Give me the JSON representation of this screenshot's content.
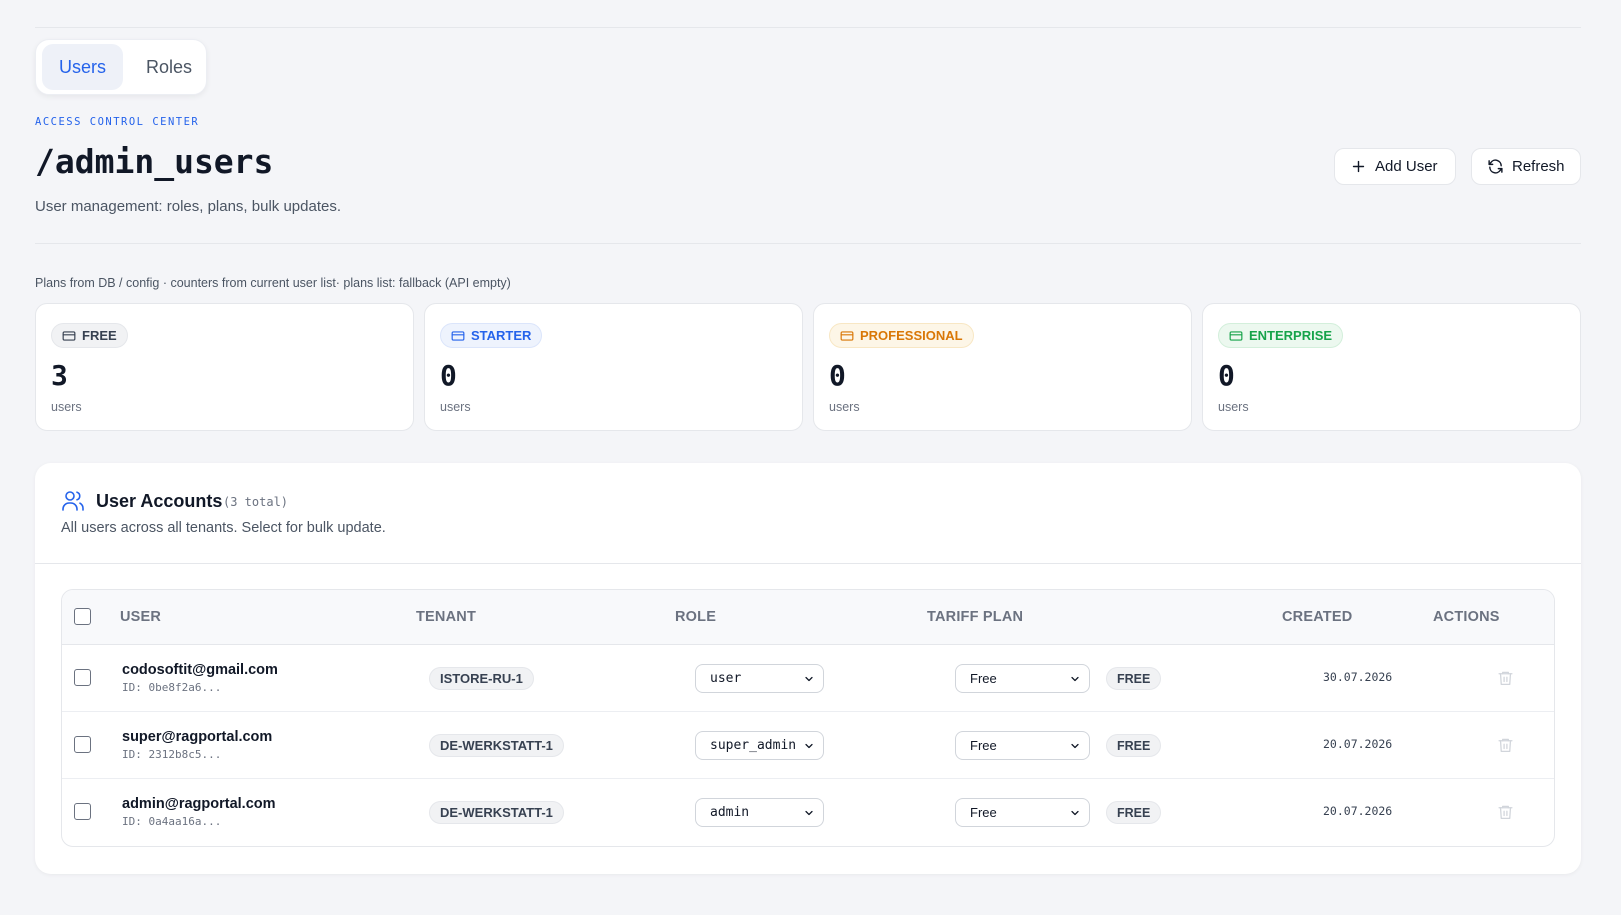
{
  "tabs": [
    {
      "label": "Users",
      "active": true
    },
    {
      "label": "Roles",
      "active": false
    }
  ],
  "header": {
    "eyebrow": "ACCESS CONTROL CENTER",
    "title": "/admin_users",
    "subtitle": "User management: roles, plans, bulk updates.",
    "add_user_label": "Add User",
    "refresh_label": "Refresh"
  },
  "plans_note": "Plans from DB / config · counters from current user list· plans list: fallback (API empty)",
  "plans": [
    {
      "name": "FREE",
      "count": "3",
      "unit": "users",
      "color": "#374151",
      "bg": "#f1f2f4",
      "border": "#e5e7eb"
    },
    {
      "name": "STARTER",
      "count": "0",
      "unit": "users",
      "color": "#2563eb",
      "bg": "#eef3fd",
      "border": "#dbe5fb"
    },
    {
      "name": "PROFESSIONAL",
      "count": "0",
      "unit": "users",
      "color": "#d97706",
      "bg": "#fdf6e7",
      "border": "#f8e7c4"
    },
    {
      "name": "ENTERPRISE",
      "count": "0",
      "unit": "users",
      "color": "#16a34a",
      "bg": "#ecf8ef",
      "border": "#d3efdb"
    }
  ],
  "accounts": {
    "title": "User Accounts",
    "count_label": "(3 total)",
    "description": "All users across all tenants. Select for bulk update.",
    "columns": [
      "USER",
      "TENANT",
      "ROLE",
      "TARIFF PLAN",
      "CREATED",
      "ACTIONS"
    ],
    "rows": [
      {
        "email": "codosoftit@gmail.com",
        "id": "ID: 0be8f2a6...",
        "tenant": "ISTORE-RU-1",
        "role": "user",
        "plan": "Free",
        "plan_badge": "FREE",
        "created": "30.07.2026"
      },
      {
        "email": "super@ragportal.com",
        "id": "ID: 2312b8c5...",
        "tenant": "DE-WERKSTATT-1",
        "role": "super_admin",
        "plan": "Free",
        "plan_badge": "FREE",
        "created": "20.07.2026"
      },
      {
        "email": "admin@ragportal.com",
        "id": "ID: 0a4aa16a...",
        "tenant": "DE-WERKSTATT-1",
        "role": "admin",
        "plan": "Free",
        "plan_badge": "FREE",
        "created": "20.07.2026"
      }
    ]
  },
  "icons": {
    "add": "plus-icon",
    "refresh": "refresh-icon",
    "plan": "credit-card-icon",
    "accounts": "users-icon",
    "select": "chevron-down-icon",
    "delete": "trash-icon"
  },
  "colors": {
    "accent": "#2563eb",
    "background": "#f4f5f8"
  }
}
